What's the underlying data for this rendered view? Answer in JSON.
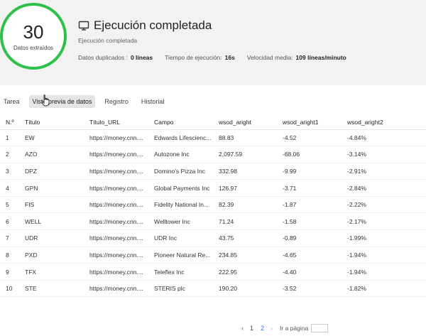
{
  "summary": {
    "count": "30",
    "count_label": "Datos extraídos",
    "title": "Ejecución completada",
    "subtitle": "Ejecución completada",
    "stats": [
      {
        "label": "Datos duplicados :",
        "value": "0 líneas"
      },
      {
        "label": "Tiempo de ejecución:",
        "value": "16s"
      },
      {
        "label": "Velocidad media:",
        "value": "109 líneas/minuto"
      }
    ],
    "accent_color": "#2ec14a"
  },
  "tabs": [
    {
      "label": "Tarea"
    },
    {
      "label": "Vista previa de datos",
      "active": true
    },
    {
      "label": "Registro"
    },
    {
      "label": "Historial"
    }
  ],
  "table": {
    "headers": [
      "N.º",
      "Título",
      "Título_URL",
      "Campo",
      "wsod_aright",
      "wsod_aright1",
      "wsod_aright2"
    ],
    "rows": [
      [
        "1",
        "EW",
        "https://money.cnn....",
        "Edwards Lifescienc...",
        "88.83",
        "-4.52",
        "-4.84%"
      ],
      [
        "2",
        "AZO",
        "https://money.cnn....",
        "Autozone Inc",
        "2,097.59",
        "-68.06",
        "-3.14%"
      ],
      [
        "3",
        "DPZ",
        "https://money.cnn....",
        "Domino's Pizza Inc",
        "332.98",
        "-9.99",
        "-2.91%"
      ],
      [
        "4",
        "GPN",
        "https://money.cnn....",
        "Global Payments Inc",
        "126.97",
        "-3.71",
        "-2.84%"
      ],
      [
        "5",
        "FIS",
        "https://money.cnn....",
        "Fidelity National In...",
        "82.39",
        "-1.87",
        "-2.22%"
      ],
      [
        "6",
        "WELL",
        "https://money.cnn....",
        "Welltower Inc",
        "71.24",
        "-1.58",
        "-2.17%"
      ],
      [
        "7",
        "UDR",
        "https://money.cnn....",
        "UDR Inc",
        "43.75",
        "-0.89",
        "-1.99%"
      ],
      [
        "8",
        "PXD",
        "https://money.cnn....",
        "Pioneer Natural Re...",
        "234.85",
        "-4.65",
        "-1.94%"
      ],
      [
        "9",
        "TFX",
        "https://money.cnn....",
        "Teleflex Inc",
        "222.95",
        "-4.40",
        "-1.94%"
      ],
      [
        "10",
        "STE",
        "https://money.cnn....",
        "STERIS plc",
        "190.20",
        "-3.52",
        "-1.82%"
      ]
    ]
  },
  "pagination": {
    "prev": "‹",
    "pages": [
      "1",
      "2"
    ],
    "current": "2",
    "next": "›",
    "goto_label": "Ir a página",
    "goto_value": ""
  }
}
